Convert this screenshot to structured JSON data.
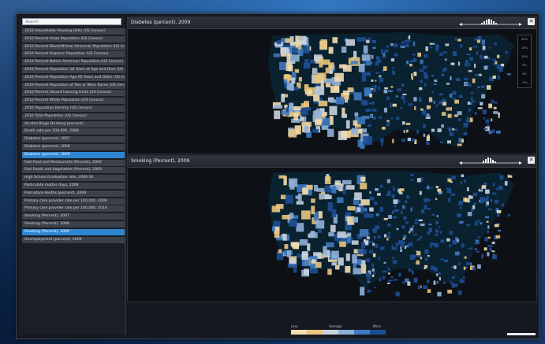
{
  "search": {
    "placeholder": "Search"
  },
  "sidebar": {
    "items": [
      {
        "label": "2010 Households Housing Units (US Census)",
        "selected": false
      },
      {
        "label": "2010 Percent Asian Population (US Census)",
        "selected": false
      },
      {
        "label": "2010 Percent Black/African American Population (US Census)",
        "selected": false
      },
      {
        "label": "2010 Percent Hispanic Population (US Census)",
        "selected": false
      },
      {
        "label": "2010 Percent Native American Population (US Census)",
        "selected": false
      },
      {
        "label": "2010 Percent Population 18 Years of Age and Over (US Census)",
        "selected": false
      },
      {
        "label": "2010 Percent Population Age 65 Years and Older (US Census)",
        "selected": false
      },
      {
        "label": "2010 Percent Population of Two or More Races (US Census)",
        "selected": false
      },
      {
        "label": "2010 Percent Vacant Housing Units (US Census)",
        "selected": false
      },
      {
        "label": "2010 Percent White Population (US Census)",
        "selected": false
      },
      {
        "label": "2010 Population Density (US Census)",
        "selected": false
      },
      {
        "label": "2010 Total Population (US Census)",
        "selected": false
      },
      {
        "label": "Alcohol Binge Drinking (percent)",
        "selected": false
      },
      {
        "label": "Death rate per 100,000, 2008",
        "selected": false
      },
      {
        "label": "Diabetes (percent), 2007",
        "selected": false
      },
      {
        "label": "Diabetes (percent), 2008",
        "selected": false
      },
      {
        "label": "Diabetes (percent), 2009",
        "selected": true
      },
      {
        "label": "Fast Food and Restaurants (Percent), 2009",
        "selected": false
      },
      {
        "label": "Fast Foods and Vegetables (Percent), 2009",
        "selected": false
      },
      {
        "label": "High School Graduation rate, 2009-10",
        "selected": false
      },
      {
        "label": "Particulate matter days, 2009",
        "selected": false
      },
      {
        "label": "Premature deaths (percent), 2009",
        "selected": false
      },
      {
        "label": "Primary care provider rate per 100,000, 2009",
        "selected": false
      },
      {
        "label": "Primary care provider rate per 100,000, 2010",
        "selected": false
      },
      {
        "label": "Smoking (Percent), 2007",
        "selected": false
      },
      {
        "label": "Smoking (Percent), 2008",
        "selected": false
      },
      {
        "label": "Smoking (Percent), 2009",
        "selected": true
      },
      {
        "label": "Unemployment (percent), 2009",
        "selected": false
      }
    ]
  },
  "panels": [
    {
      "title": "Diabetes (percent), 2009",
      "close": "✕"
    },
    {
      "title": "Smoking (Percent), 2009",
      "close": "✕"
    }
  ],
  "legend_box": {
    "labels": [
      "20%",
      "15%",
      "10%",
      "5%",
      "0%",
      "-5%"
    ]
  },
  "color_legend": {
    "low_label": "Less",
    "mid_label": "Average",
    "high_label": "More",
    "colors": [
      "#f2ddb0",
      "#e9c57e",
      "#c9d3de",
      "#8fb0d6",
      "#3f79bf",
      "#1d4e93"
    ]
  },
  "colors": {
    "map_background": "#0a2130",
    "county_light": "#f2ddb0",
    "county_mid": "#c9d3de",
    "county_dark": "#1d4e93",
    "selection": "#2f86d0"
  }
}
